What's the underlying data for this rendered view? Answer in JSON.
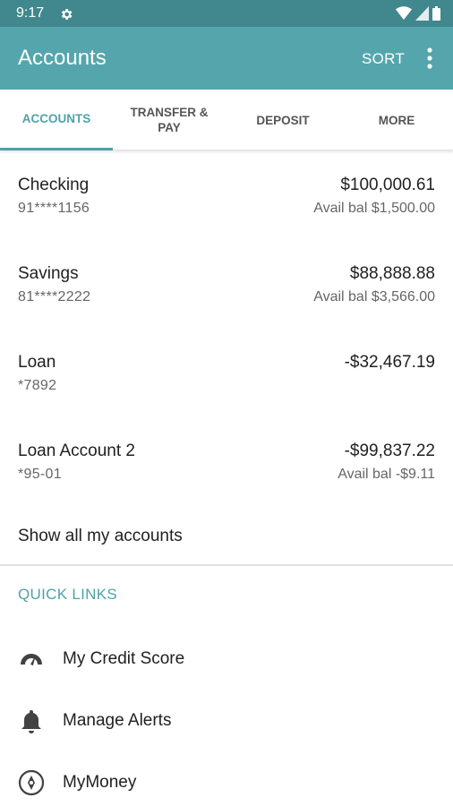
{
  "status_bar": {
    "time": "9:17"
  },
  "app_bar": {
    "title": "Accounts",
    "sort_label": "SORT"
  },
  "tabs": [
    {
      "label": "ACCOUNTS",
      "active": true
    },
    {
      "label": "TRANSFER & PAY",
      "active": false
    },
    {
      "label": "DEPOSIT",
      "active": false
    },
    {
      "label": "MORE",
      "active": false
    }
  ],
  "accounts": [
    {
      "name": "Checking",
      "number": "91****1156",
      "balance": "$100,000.61",
      "available": "Avail bal $1,500.00"
    },
    {
      "name": "Savings",
      "number": "81****2222",
      "balance": "$88,888.88",
      "available": "Avail bal $3,566.00"
    },
    {
      "name": "Loan",
      "number": "*7892",
      "balance": "-$32,467.19",
      "available": ""
    },
    {
      "name": "Loan Account 2",
      "number": "*95-01",
      "balance": "-$99,837.22",
      "available": "Avail bal -$9.11"
    }
  ],
  "show_all_label": "Show all my accounts",
  "quick_links": {
    "title": "QUICK LINKS",
    "items": [
      {
        "label": "My Credit Score",
        "icon": "speedometer-icon"
      },
      {
        "label": "Manage Alerts",
        "icon": "bell-icon"
      },
      {
        "label": "MyMoney",
        "icon": "compass-icon"
      }
    ]
  },
  "colors": {
    "status_bar": "#40888d",
    "app_bar": "#55a6ac",
    "accent": "#4fa2a8",
    "text_primary": "#212121",
    "text_secondary": "#666666"
  }
}
